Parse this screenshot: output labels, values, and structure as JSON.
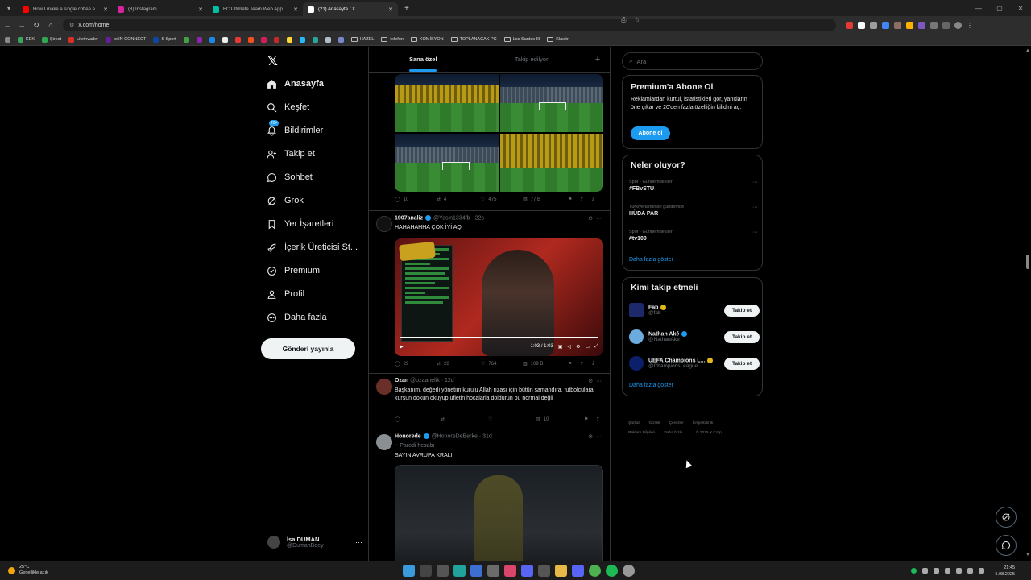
{
  "browser": {
    "tabs": [
      {
        "title": "How I make a single coffee ev...",
        "fav_color": "#ff0000"
      },
      {
        "title": "(8) Instagram",
        "fav_color": "#d6249f"
      },
      {
        "title": "FC Ultimate Team Web App - E...",
        "fav_color": "#00bfa5"
      },
      {
        "title": "(21) Anasayfa / X",
        "fav_color": "#ffffff"
      }
    ],
    "url": "x.com/home",
    "bookmarks": [
      {
        "label": "KEK",
        "type": "site",
        "color": "#3ba55d"
      },
      {
        "label": "Şirket",
        "type": "site",
        "color": "#2fa84f"
      },
      {
        "label": "Lifeinvader",
        "type": "site",
        "color": "#d93025"
      },
      {
        "label": "beIN CONNECT",
        "type": "site",
        "color": "#6a1b9a"
      },
      {
        "label": "S Sport",
        "type": "site",
        "color": "#0d47a1"
      },
      {
        "label": "HAZEL",
        "type": "folder"
      },
      {
        "label": "telefon",
        "type": "folder"
      },
      {
        "label": "KOMİSYON",
        "type": "folder"
      },
      {
        "label": "TOPLANACAK PC",
        "type": "folder"
      },
      {
        "label": "Los Santos III",
        "type": "folder"
      },
      {
        "label": "Klasör",
        "type": "folder"
      }
    ]
  },
  "nav": {
    "items": [
      {
        "label": "Anasayfa",
        "icon": "home-icon"
      },
      {
        "label": "Keşfet",
        "icon": "search-icon"
      },
      {
        "label": "Bildirimler",
        "icon": "bell-icon",
        "badge": "20+"
      },
      {
        "label": "Takip et",
        "icon": "add-user-icon"
      },
      {
        "label": "Sohbet",
        "icon": "chat-icon"
      },
      {
        "label": "Grok",
        "icon": "grok-icon"
      },
      {
        "label": "Yer İşaretleri",
        "icon": "bookmark-icon"
      },
      {
        "label": "İçerik Üreticisi St...",
        "icon": "rocket-icon"
      },
      {
        "label": "Premium",
        "icon": "premium-icon"
      },
      {
        "label": "Profil",
        "icon": "profile-icon"
      },
      {
        "label": "Daha fazla",
        "icon": "more-circle-icon"
      }
    ],
    "post_button": "Gönderi yayınla",
    "user": {
      "name": "İsa DUMAN",
      "handle": "@DumanBeey"
    }
  },
  "feed": {
    "tabs": [
      "Sana özel",
      "Takip edilyor"
    ],
    "tweets": [
      {
        "stats": {
          "replies": "10",
          "retweets": "4",
          "likes": "475",
          "views": "77 B"
        }
      },
      {
        "name": "1907analiz",
        "handle": "@Yasin1334fb",
        "time": "22s",
        "text": "HAHAHAHHA ÇOK İYİ AQ",
        "video_time": "1:03 / 1:03",
        "stats": {
          "replies": "29",
          "retweets": "28",
          "likes": "764",
          "views": "109 B"
        }
      },
      {
        "name": "Ozan",
        "handle": "@ozaanelik",
        "time": "12d",
        "text": "Başkanım, değerli yönetim kurulu Allah rızası için bütün samandıra, futbolculara kurşun dökün okuyup üfletin hocalarla doldurun bu normal değil",
        "stats": {
          "replies": "",
          "retweets": "",
          "likes": "",
          "views": "10"
        }
      },
      {
        "name": "Honorede",
        "handle": "@HonoreDeBerke",
        "time": "31d",
        "label": "Parodi hesabı",
        "text": "SAYIN AVRUPA KRALI"
      }
    ]
  },
  "sidebar": {
    "search_placeholder": "Ara",
    "premium": {
      "title": "Premium'a Abone Ol",
      "text": "Reklamlardan kurtul, istatistikleri gör, yanıtların öne çıkar ve 20'den fazla özelliğin kilidini aç.",
      "button": "Abone ol"
    },
    "trends": {
      "title": "Neler oluyor?",
      "items": [
        {
          "category": "Spor · Gündemdekiler",
          "name": "#FBvSTU"
        },
        {
          "category": "Türkiye tarihinde gündemde",
          "name": "HÜDA PAR"
        },
        {
          "category": "Spor · Gündemdekiler",
          "name": "#tv100"
        }
      ],
      "show_more": "Daha fazla göster"
    },
    "who_to_follow": {
      "title": "Kimi takip etmeli",
      "items": [
        {
          "name": "Fab",
          "handle": "@fab",
          "button": "Takip et",
          "color": "#1c2a6b"
        },
        {
          "name": "Nathan Aké",
          "handle": "@NathanAke",
          "button": "Takip et",
          "color": "#6cabdd"
        },
        {
          "name": "UEFA Champions L...",
          "handle": "@ChampionsLeague",
          "button": "Takip et",
          "color": "#0b1f6b"
        }
      ],
      "show_more": "Daha fazla göster"
    },
    "footer": [
      "Şartlar",
      "Gizlilik",
      "Çerezler",
      "Erişilebilirlik",
      "Reklam Bilgileri",
      "Daha fazla ...",
      "© 2025 X Corp."
    ]
  },
  "taskbar": {
    "weather": {
      "temp": "25°C",
      "desc": "Genellikle açık"
    },
    "time": "21:45",
    "date": "5.08.2025"
  }
}
